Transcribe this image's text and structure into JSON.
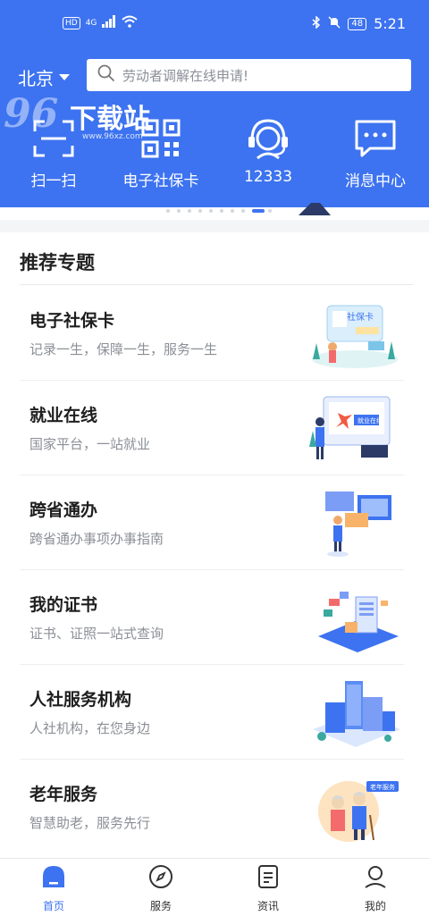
{
  "status": {
    "left_badge": "HD",
    "network": "4G",
    "battery": "48",
    "time": "5:21"
  },
  "header": {
    "city": "北京",
    "search_placeholder": "劳动者调解在线申请!"
  },
  "watermark": {
    "brand_num": "96",
    "brand_text": "下载站",
    "url": "www.96xz.com"
  },
  "quick_actions": [
    {
      "label": "扫一扫",
      "icon": "scan-icon"
    },
    {
      "label": "电子社保卡",
      "icon": "qr-code-icon"
    },
    {
      "label": "12333",
      "icon": "headset-icon"
    },
    {
      "label": "消息中心",
      "icon": "message-icon"
    }
  ],
  "section": {
    "title": "推荐专题"
  },
  "topics": [
    {
      "title": "电子社保卡",
      "subtitle": "记录一生，保障一生，服务一生",
      "image_caption": "社保卡"
    },
    {
      "title": "就业在线",
      "subtitle": "国家平台，一站就业",
      "image_caption": "就业在线"
    },
    {
      "title": "跨省通办",
      "subtitle": "跨省通办事项办事指南",
      "image_caption": ""
    },
    {
      "title": "我的证书",
      "subtitle": "证书、证照一站式查询",
      "image_caption": ""
    },
    {
      "title": "人社服务机构",
      "subtitle": "人社机构，在您身边",
      "image_caption": ""
    },
    {
      "title": "老年服务",
      "subtitle": "智慧助老，服务先行",
      "image_caption": "老年服务"
    }
  ],
  "tabs": [
    {
      "label": "首页",
      "icon": "home-icon",
      "active": true
    },
    {
      "label": "服务",
      "icon": "compass-icon",
      "active": false
    },
    {
      "label": "资讯",
      "icon": "news-icon",
      "active": false
    },
    {
      "label": "我的",
      "icon": "user-icon",
      "active": false
    }
  ],
  "colors": {
    "brand": "#3d73f0",
    "background": "#f4f5f7"
  }
}
